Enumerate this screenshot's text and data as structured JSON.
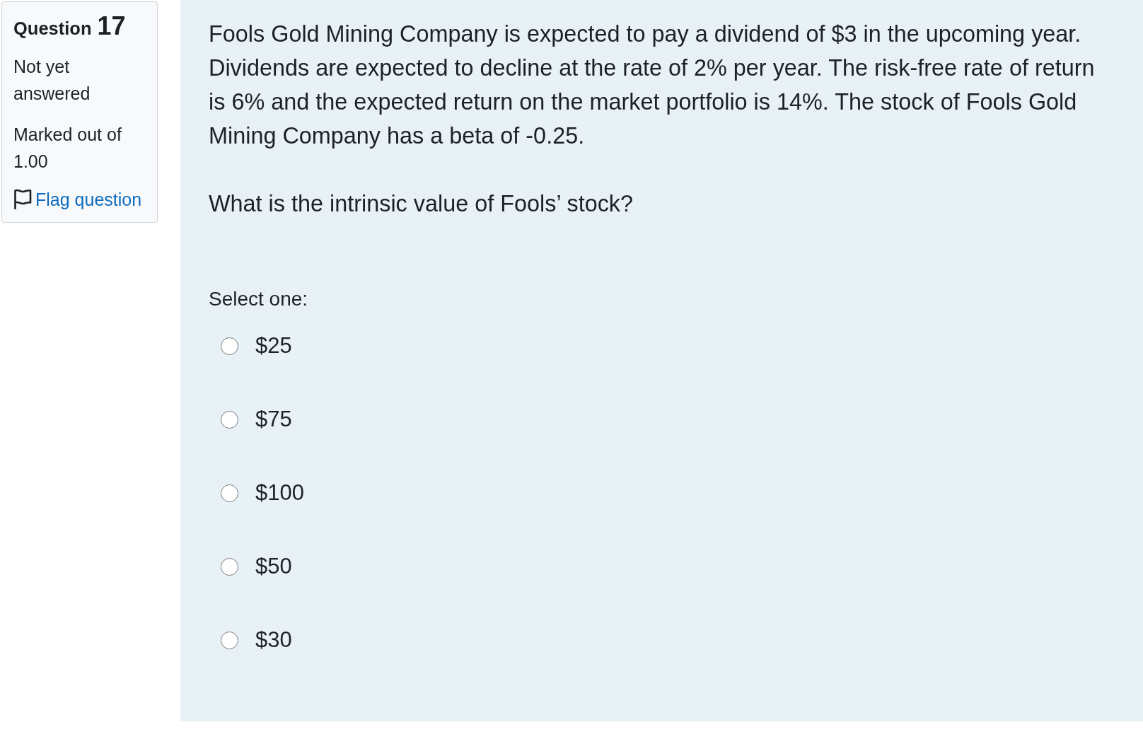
{
  "question_info": {
    "label": "Question",
    "number": "17",
    "status": "Not yet answered",
    "grade": "Marked out of 1.00",
    "flag_link": "Flag question",
    "flagged": false
  },
  "question": {
    "paragraphs": [
      "Fools Gold Mining Company is expected to pay a dividend of $3 in the upcoming year. Dividends are expected to decline at the rate of 2% per year. The risk-free rate of return is 6% and the expected return on the market portfolio is 14%. The stock of Fools Gold Mining Company has a beta of -0.25.",
      "What is the intrinsic value of Fools’ stock?"
    ],
    "prompt": "Select one:",
    "options": [
      {
        "label": "$25",
        "selected": false
      },
      {
        "label": "$75",
        "selected": false
      },
      {
        "label": "$100",
        "selected": false
      },
      {
        "label": "$50",
        "selected": false
      },
      {
        "label": "$30",
        "selected": false
      }
    ]
  }
}
